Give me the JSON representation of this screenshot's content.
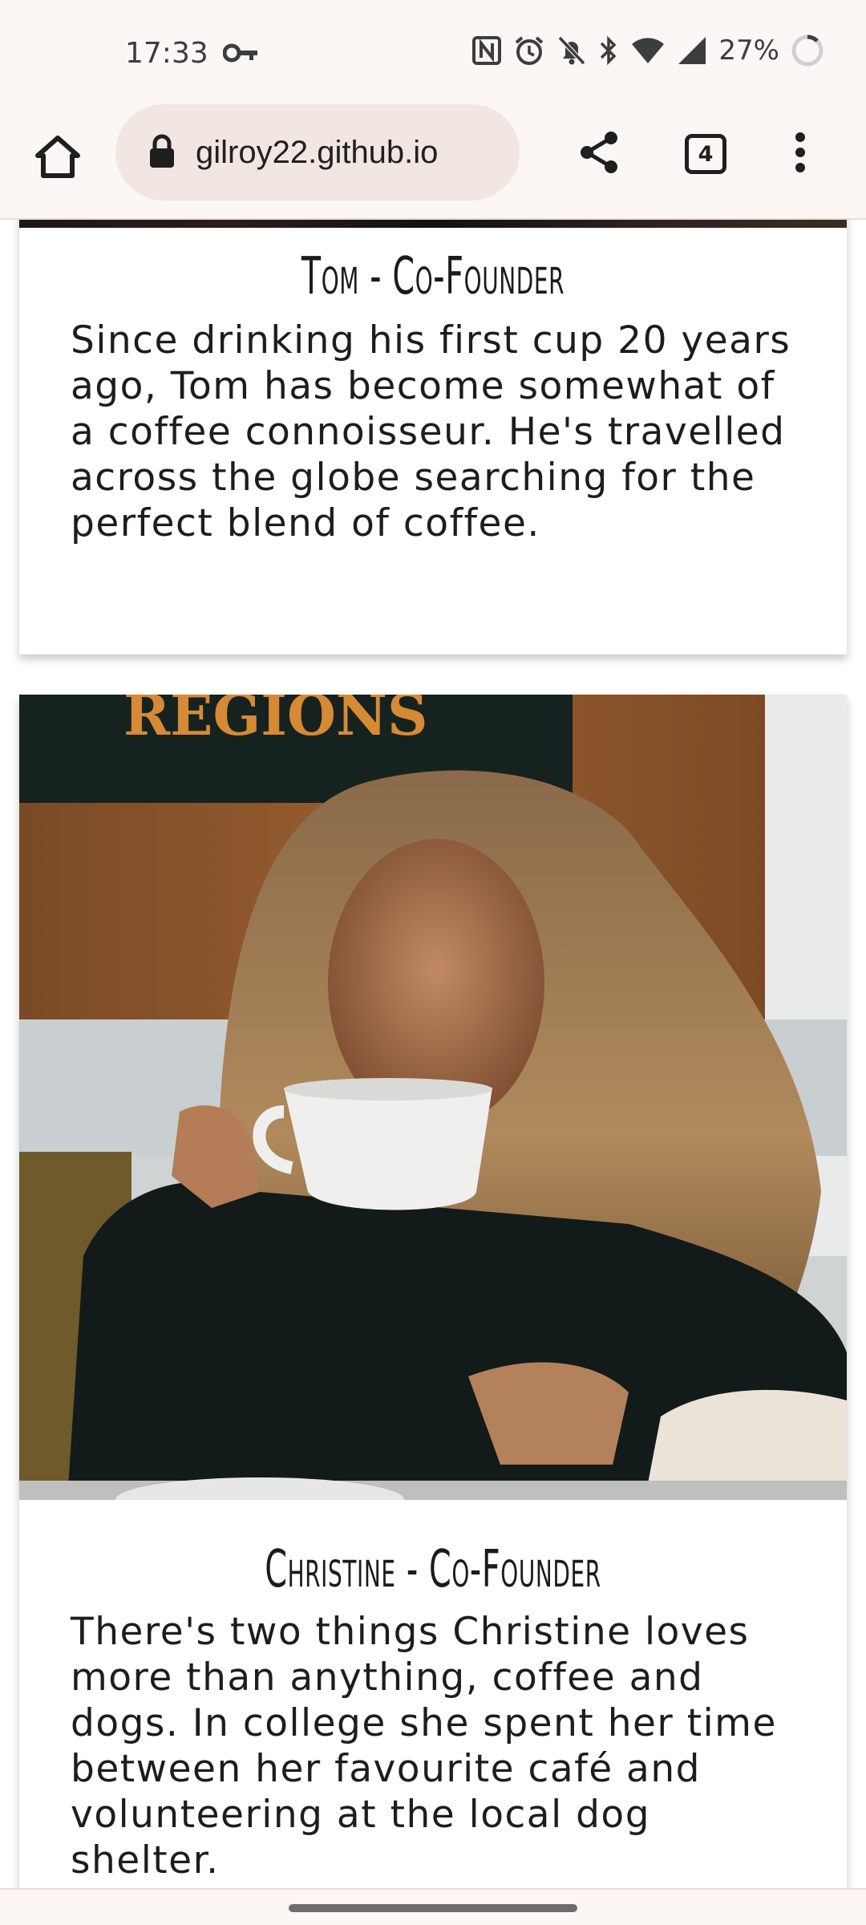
{
  "status_bar": {
    "time": "17:33",
    "battery": "27%"
  },
  "browser": {
    "url": "gilroy22.github.io",
    "tab_count": "4"
  },
  "cards": [
    {
      "title": "Tom - Co-Founder",
      "text": "Since drinking his first cup 20 years ago, Tom has become somewhat of a coffee connoisseur. He's travelled across the globe searching for the perfect blend of coffee."
    },
    {
      "title": "Christine - Co-Founder",
      "text": "There's two things Christine loves more than anything, coffee and dogs. In college she spent her time between her favourite café and volunteering at the local dog shelter."
    }
  ],
  "photo": {
    "sign_text": "REGIONS"
  },
  "colors": {
    "chrome_bg": "#fcf7f4",
    "url_pill": "#f1e6e2"
  }
}
